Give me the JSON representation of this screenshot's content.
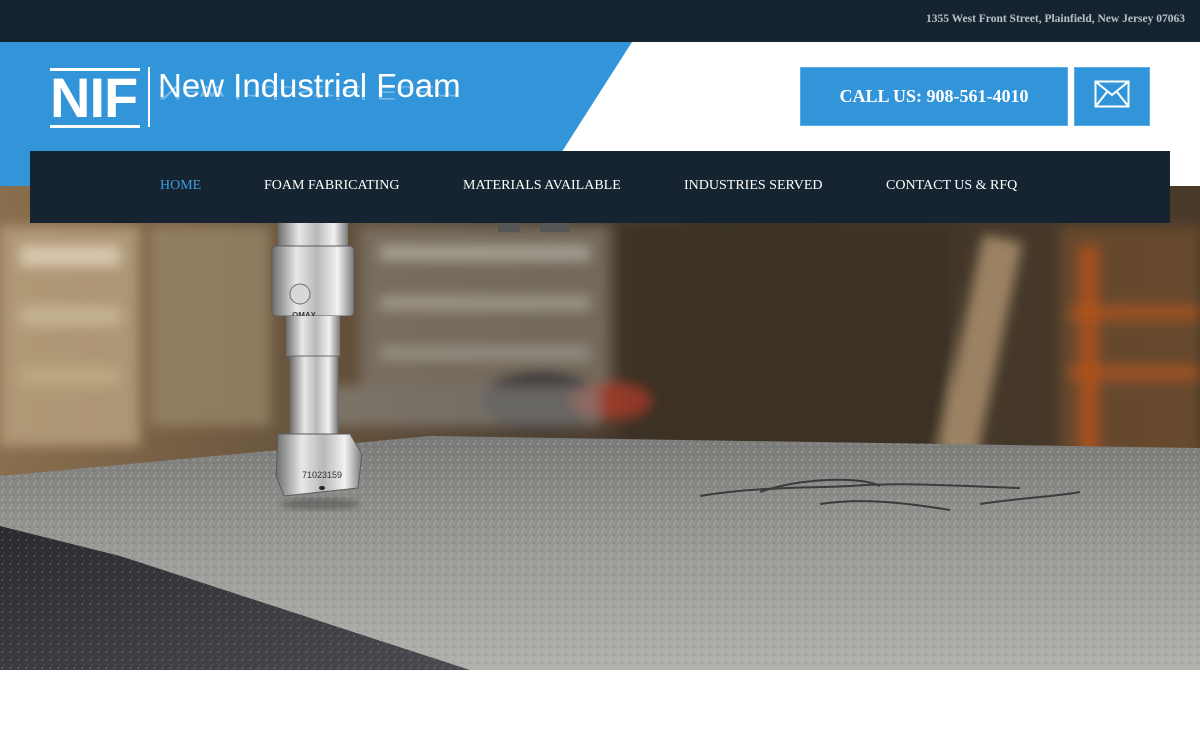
{
  "topbar": {
    "address": "1355 West Front Street, Plainfield, New Jersey 07063"
  },
  "logo": {
    "mark": "NIF",
    "name": "New Industrial Foam"
  },
  "contact": {
    "call_label": "CALL US: 908-561-4010",
    "mail_icon": "envelope-icon"
  },
  "nav": {
    "items": [
      {
        "label": "HOME",
        "active": true
      },
      {
        "label": "FOAM FABRICATING",
        "active": false
      },
      {
        "label": "MATERIALS AVAILABLE",
        "active": false
      },
      {
        "label": "INDUSTRIES SERVED",
        "active": false
      },
      {
        "label": "CONTACT US & RFQ",
        "active": false
      }
    ]
  },
  "hero": {
    "image": "waterjet-cutting-foam-photo",
    "nozzle_brand": "OMAX",
    "nozzle_serial": "71023159"
  },
  "colors": {
    "topbar_bg": "#162431",
    "brand_blue": "#3295da",
    "nav_bg": "#162431",
    "nav_active": "#3b9ee0"
  }
}
